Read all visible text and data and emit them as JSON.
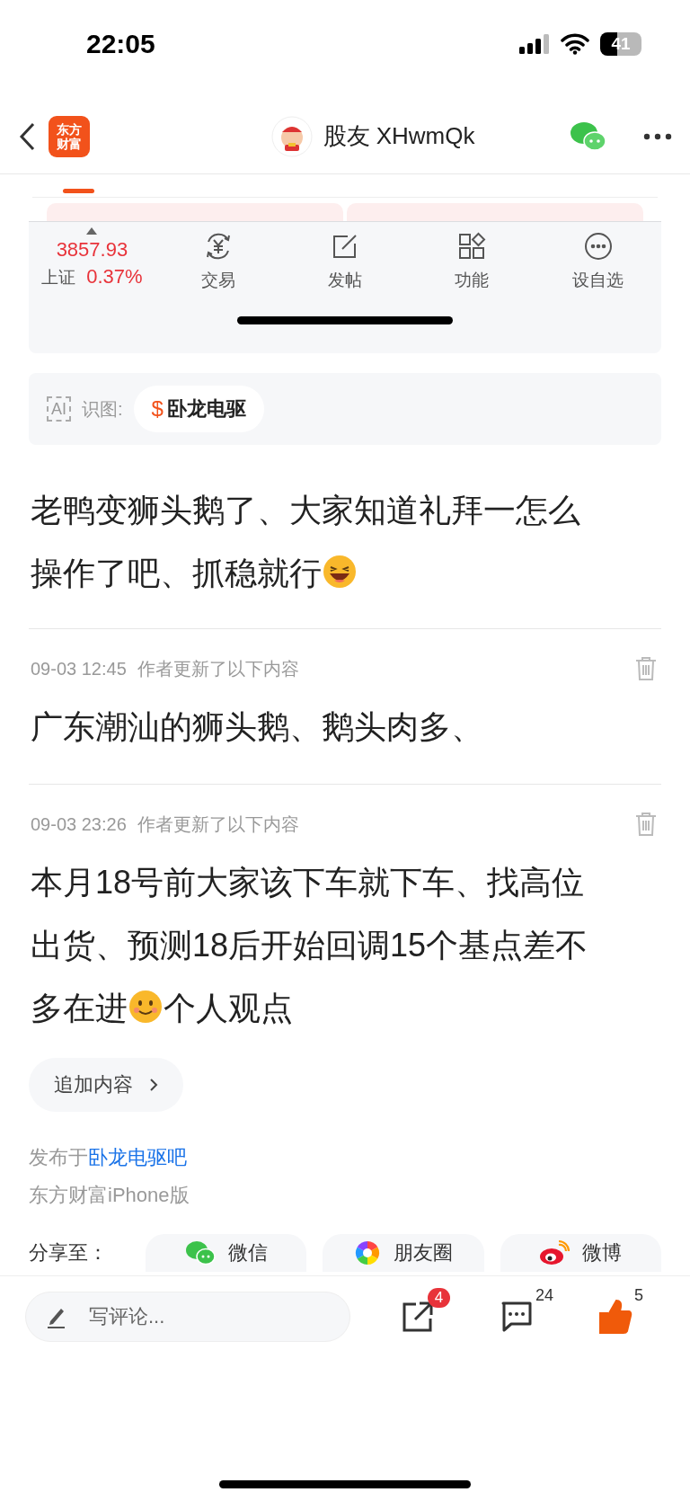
{
  "status_bar": {
    "time": "22:05",
    "battery": "41"
  },
  "nav": {
    "logo": [
      "东方",
      "财富"
    ],
    "title": "股友 XHwmQk"
  },
  "ticker": {
    "value": "3857.93",
    "name": "上证",
    "change": "0.37%"
  },
  "actions": [
    {
      "label": "交易"
    },
    {
      "label": "发帖"
    },
    {
      "label": "功能"
    },
    {
      "label": "设自选"
    }
  ],
  "image_tags": {
    "badge": "AI",
    "label": "识图:",
    "tags": [
      {
        "symbol": "$",
        "name": "卧龙电驱"
      }
    ]
  },
  "post": [
    {
      "kind": "text",
      "text": "老鸭变狮头鹅了、大家知道礼拜一怎么"
    },
    {
      "kind": "text",
      "text": "操作了吧、抓稳就行"
    },
    {
      "kind": "laughing"
    }
  ],
  "updates": [
    {
      "time": "09-03 12:45",
      "note": "作者更新了以下内容",
      "content": [
        {
          "kind": "text",
          "text": "广东潮汕的狮头鹅、鹅头肉多、"
        }
      ]
    },
    {
      "time": "09-03 23:26",
      "note": "作者更新了以下内容",
      "content": [
        {
          "kind": "text",
          "text": "本月18号前大家该下车就下车、找高位"
        },
        {
          "kind": "text",
          "text": "出货、预测18后开始回调15个基点差不"
        },
        {
          "kind": "text",
          "text": "多在进"
        },
        {
          "kind": "smiling"
        },
        {
          "kind": "text",
          "text": "个人观点"
        }
      ]
    }
  ],
  "append_button": "追加内容",
  "published": {
    "prefix": "发布于",
    "link": "卧龙电驱吧"
  },
  "client": "东方财富iPhone版",
  "share": {
    "label": "分享至：",
    "targets": [
      {
        "label": "微信",
        "kind": "wechat"
      },
      {
        "label": "朋友圈",
        "kind": "moments"
      },
      {
        "label": "微博",
        "kind": "weibo"
      }
    ]
  },
  "bottom_bar": {
    "comment_placeholder": "写评论...",
    "share_badge": "4",
    "comments": "24",
    "likes": "5",
    "liked": true
  }
}
